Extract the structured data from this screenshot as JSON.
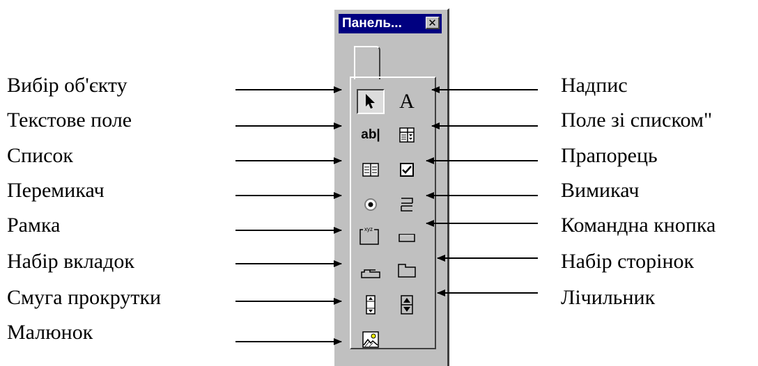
{
  "window": {
    "title": "Панель...",
    "close_glyph": "✕"
  },
  "left_labels": [
    "Вибір об'єкту",
    "Текстове поле",
    "Список",
    "Перемикач",
    "Рамка",
    "Набір вкладок",
    "Смуга прокрутки",
    "Малюнок"
  ],
  "right_labels": [
    "Надпис",
    "Поле зі списком\"",
    "Прапорець",
    "Вимикач",
    "Командна кнопка",
    "Набір сторінок",
    "Лічильник"
  ],
  "tools": {
    "select_object": "select-arrow-icon",
    "label": "A",
    "text_box": "ab|",
    "combo_box": "combo-box-icon",
    "list_box": "list-box-icon",
    "check_box": "check-box-icon",
    "option_button": "option-button-icon",
    "toggle_button": "toggle-button-icon",
    "frame": "xyz",
    "command_button": "command-button-icon",
    "tab_strip": "tab-strip-icon",
    "multi_page": "multi-page-icon",
    "scroll_bar": "scroll-bar-icon",
    "spin_button": "spin-button-icon",
    "image": "image-icon"
  },
  "colors": {
    "titlebar": "#000080",
    "face": "#c0c0c0",
    "shadow": "#404040",
    "highlight": "#ffffff"
  }
}
